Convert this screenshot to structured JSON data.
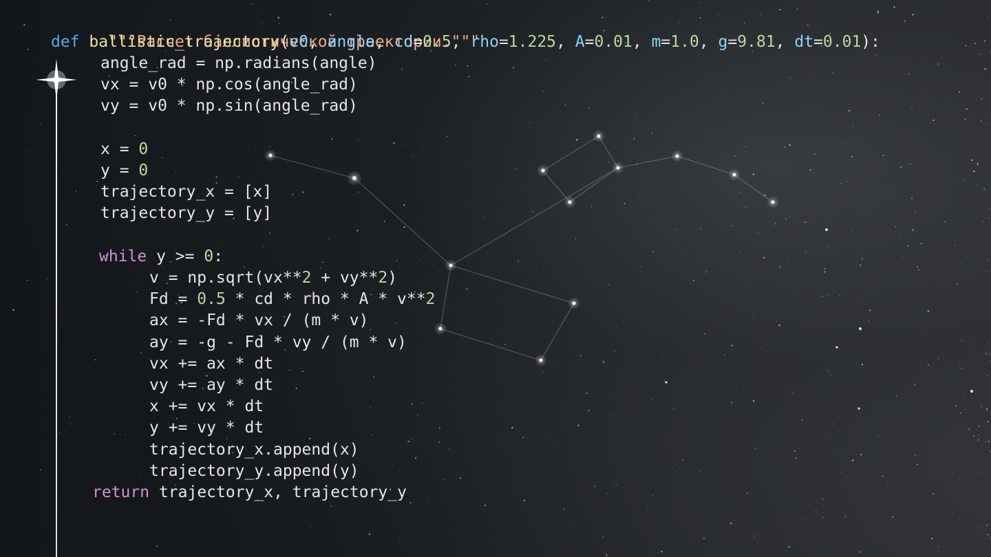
{
  "code_lines": [
    {
      "docstring": "\"\"\"Расчет баллистической траектории.\"\"\""
    },
    {
      "def_kw": "def",
      "func_name": "ballistic_trajectory",
      "open": "(",
      "params": [
        {
          "name": "v0",
          "sep": ", "
        },
        {
          "name": "angle",
          "sep": ", "
        },
        {
          "name": "cd",
          "eq": "=",
          "value": "0.5",
          "sep": ", "
        },
        {
          "name": "rho",
          "eq": "=",
          "value": "1.225",
          "sep": ", "
        },
        {
          "name": "A",
          "eq": "=",
          "value": "0.01",
          "sep": ", "
        },
        {
          "name": "m",
          "eq": "=",
          "value": "1.0",
          "sep": ", "
        },
        {
          "name": "g",
          "eq": "=",
          "value": "9.81",
          "sep": ", "
        },
        {
          "name": "dt",
          "eq": "=",
          "value": "0.01",
          "sep": ""
        }
      ],
      "close": "):"
    },
    {
      "text": "angle_rad = np.radians(angle)"
    },
    {
      "text": "vx = v0 * np.cos(angle_rad)"
    },
    {
      "text": "vy = v0 * np.sin(angle_rad)"
    },
    {
      "lhs": "x = ",
      "num": "0"
    },
    {
      "lhs": "y = ",
      "num": "0"
    },
    {
      "text": "trajectory_x = [x]"
    },
    {
      "text": "trajectory_y = [y]"
    },
    {
      "kw": "while",
      "mid": " y >= ",
      "num": "0",
      "end": ":"
    },
    {
      "pre": "v = np.sqrt(vx**",
      "n1": "2",
      "mid": " + vy**",
      "n2": "2",
      "end": ")"
    },
    {
      "pre": "Fd = ",
      "n1": "0.5",
      "mid": " * cd * rho * A * v**",
      "n2": "2"
    },
    {
      "text": "ax = -Fd * vx / (m * v)"
    },
    {
      "text": "ay = -g - Fd * vy / (m * v)"
    },
    {
      "text": "vx += ax * dt"
    },
    {
      "text": "vy += ay * dt"
    },
    {
      "text": "x += vx * dt"
    },
    {
      "text": "y += vy * dt"
    },
    {
      "text": "trajectory_x.append(x)"
    },
    {
      "text": "trajectory_y.append(y)"
    },
    {
      "kw": "return",
      "rest": " trajectory_x, trajectory_y"
    }
  ],
  "colors": {
    "docstring": "#e8a98c",
    "keyword": "#5aa9e6",
    "function": "#e9e2a2",
    "parameter": "#8fd0ff",
    "number": "#b9d9a3",
    "control": "#d68bd8",
    "text": "#e4e6e8",
    "background": "#15191c"
  },
  "decorations": {
    "timeline_marker": "sparkle-star-icon",
    "background_art": "constellation-starfield"
  }
}
